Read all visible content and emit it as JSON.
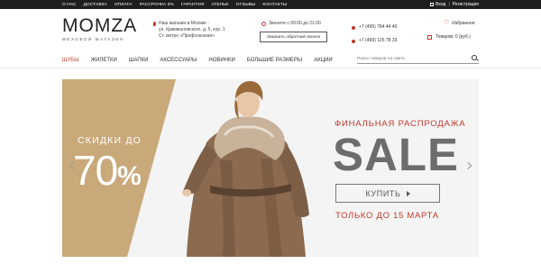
{
  "topnav": [
    "О НАС",
    "ДОСТАВКА",
    "ОПЛАТА",
    "РАССРОЧКА 0%",
    "ГАРАНТИЯ",
    "АТЕЛЬЕ",
    "ОТЗЫВЫ",
    "КОНТАКТЫ"
  ],
  "auth": {
    "login": "Вход",
    "register": "Регистрация",
    "separator": "|"
  },
  "logo": {
    "brand": "MOMZA",
    "tagline": "МЕХОВОЙ МАГАЗИН"
  },
  "address": {
    "line1": "Наш магазин в Москве :",
    "line2": "ул. Кржижановского, д. 5, кор. 1",
    "line3": "Ст. метро «Профсоюзная»"
  },
  "hours": {
    "text": "Звоните с 09:00 до 21:00"
  },
  "callback": {
    "label": "Заказать обратный звонок"
  },
  "phones": [
    "+7 (495) 784 44 40",
    "+7 (499) 125 78 33"
  ],
  "favorites": {
    "label": "Избранное"
  },
  "cart": {
    "label": "Товаров: 0 (руб.)"
  },
  "mainnav": [
    "ШУБЫ",
    "ЖИЛЕТКИ",
    "ШАПКИ",
    "АКСЕССУАРЫ",
    "НОВИНКИ",
    "БОЛЬШИЕ РАЗМЕРЫ",
    "АКЦИИ"
  ],
  "search": {
    "placeholder": "Поиск товаров на сайте"
  },
  "banner": {
    "discount_label": "СКИДКИ ДО",
    "discount_value": "70",
    "discount_percent": "%",
    "final_sale": "ФИНАЛЬНАЯ РАСПРОДАЖА",
    "sale": "SALE",
    "buy": "КУПИТЬ",
    "until": "ТОЛЬКО ДО 15 МАРТА"
  },
  "colors": {
    "accent": "#c0392b",
    "gold": "#c9a97a",
    "topbar": "#1e1e1e",
    "banner_bg": "#f4f4f4"
  }
}
